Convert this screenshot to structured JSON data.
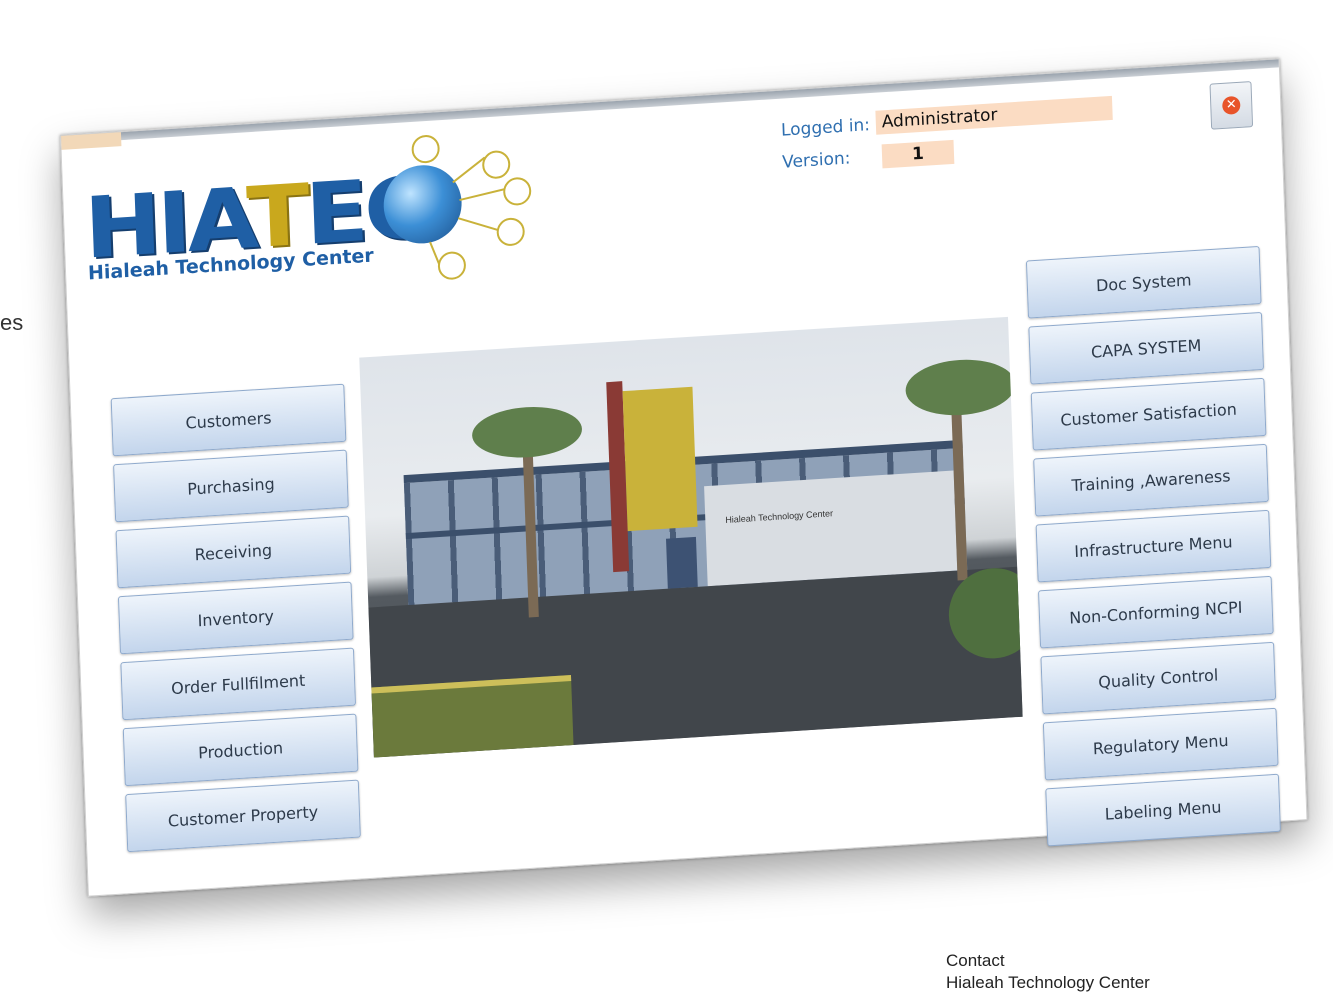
{
  "side_text": "es",
  "contact": {
    "line1": "Contact",
    "line2": "Hialeah Technology Center"
  },
  "app": {
    "logo": {
      "word_left": "HIA",
      "word_t": "T",
      "word_right": "EC",
      "subtitle": "Hialeah Technology Center"
    },
    "logged_in_label": "Logged in:",
    "logged_in_value": "Administrator",
    "version_label": "Version:",
    "version_value": "1",
    "photo_sign": "Hialeah Technology Center",
    "left_menu": [
      "Customers",
      "Purchasing",
      "Receiving",
      "Inventory",
      "Order Fullfilment",
      "Production",
      "Customer Property"
    ],
    "right_menu": [
      "Doc System",
      "CAPA SYSTEM",
      "Customer Satisfaction",
      "Training ,Awareness",
      "Infrastructure Menu",
      "Non-Conforming NCPI",
      "Quality Control",
      "Regulatory Menu",
      "Labeling Menu"
    ]
  },
  "colors": {
    "brand_blue": "#1f5fa5",
    "brand_gold": "#c9a81d",
    "field_bg": "#fbdcc3",
    "button_top": "#eef4fb",
    "button_bottom": "#c3d5ec"
  },
  "icons": {
    "close": "close-circle-icon",
    "globe": "globe-network-icon"
  }
}
